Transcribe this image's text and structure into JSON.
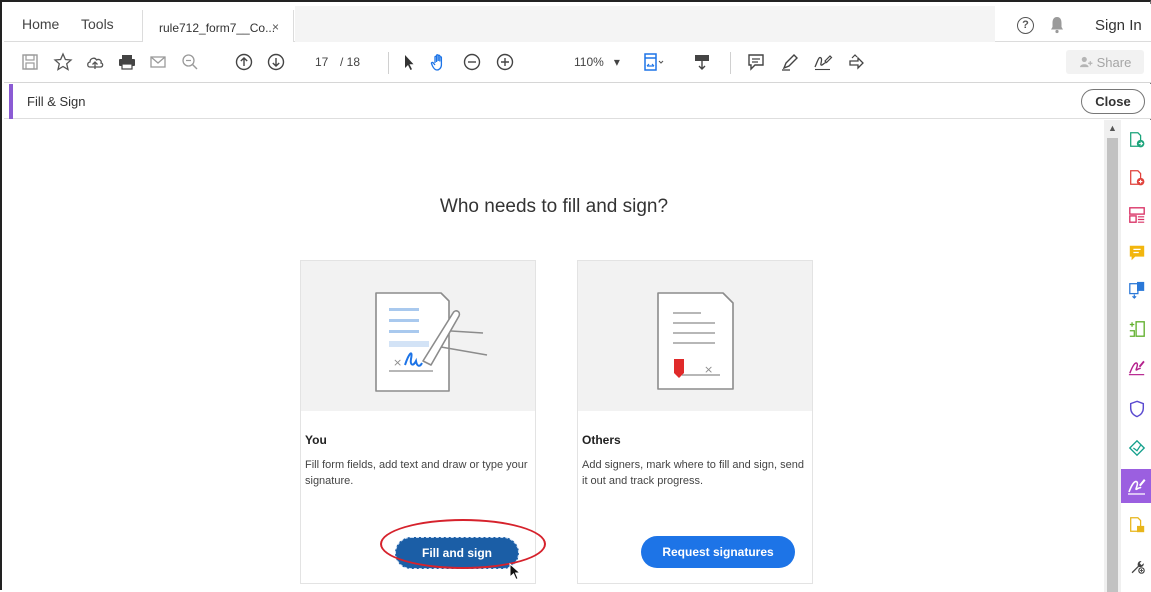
{
  "tabbar": {
    "home_label": "Home",
    "tools_label": "Tools",
    "doc_tab_title": "rule712_form7__Co...",
    "doc_tab_close": "×",
    "help_glyph": "?",
    "signin_label": "Sign In"
  },
  "toolbar": {
    "page_current": "17",
    "page_total": "/ 18",
    "zoom_value": "110%",
    "zoom_arrow": "▾",
    "share_label": "Share"
  },
  "fillsign": {
    "title": "Fill & Sign",
    "close_label": "Close"
  },
  "main": {
    "heading": "Who needs to fill and sign?",
    "you_card": {
      "title": "You",
      "description": "Fill form fields, add text and draw or type your signature.",
      "button_label": "Fill and sign"
    },
    "others_card": {
      "title": "Others",
      "description": "Add signers, mark where to fill and sign, send it out and track progress.",
      "button_label": "Request signatures"
    }
  },
  "colors": {
    "accent_purple": "#8b5bd4",
    "primary_blue": "#1d74e7",
    "annotation_red": "#d6222c"
  }
}
